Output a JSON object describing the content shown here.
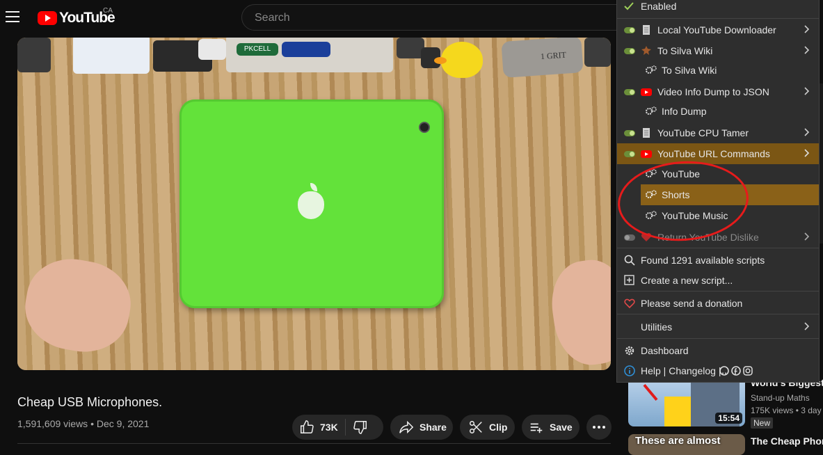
{
  "header": {
    "logo_text": "YouTube",
    "country_code": "CA",
    "search_placeholder": "Search"
  },
  "video": {
    "title": "Cheap USB Microphones.",
    "views": "1,591,609 views",
    "date": "Dec 9, 2021",
    "battery_label": "PKCELL",
    "stone_label": "1 GRIT"
  },
  "actions": {
    "likes": "73K",
    "share": "Share",
    "clip": "Clip",
    "save": "Save"
  },
  "recommendations": [
    {
      "title": "World's Biggest",
      "channel": "Stand-up Maths",
      "views": "175K views",
      "age": "3 day",
      "badge": "New",
      "duration": "15:54"
    },
    {
      "title": "The Cheap Phone",
      "thumb_text": "These are almost"
    }
  ],
  "menu": {
    "enabled_label": "Enabled",
    "scripts": [
      {
        "name": "Local YouTube Downloader",
        "enabled": true,
        "icon": "document-icon",
        "has_submenu": true
      },
      {
        "name": "To Silva Wiki",
        "enabled": true,
        "icon": "sheriff-icon",
        "has_submenu": true,
        "command": "To Silva Wiki"
      },
      {
        "name": "Video Info Dump to JSON",
        "enabled": true,
        "icon": "youtube-icon",
        "has_submenu": true,
        "command": "Info Dump"
      },
      {
        "name": "YouTube CPU Tamer",
        "enabled": true,
        "icon": "document-icon",
        "has_submenu": true
      },
      {
        "name": "YouTube URL Commands",
        "enabled": true,
        "icon": "youtube-icon",
        "has_submenu": true,
        "highlighted": true,
        "commands": [
          "YouTube",
          "Shorts",
          "YouTube Music"
        ],
        "highlighted_command": "Shorts"
      },
      {
        "name": "Return YouTube Dislike",
        "enabled": false,
        "icon": "heart-icon",
        "has_submenu": true
      }
    ],
    "found_scripts": "Found 1291 available scripts",
    "create_script": "Create a new script...",
    "donation": "Please send a donation",
    "utilities": "Utilities",
    "dashboard": "Dashboard",
    "help": "Help | Changelog |",
    "colors": {
      "highlight": "#7b5614",
      "toggle_on": "#6b8f3a",
      "annotation_circle": "#e61b1b"
    }
  }
}
